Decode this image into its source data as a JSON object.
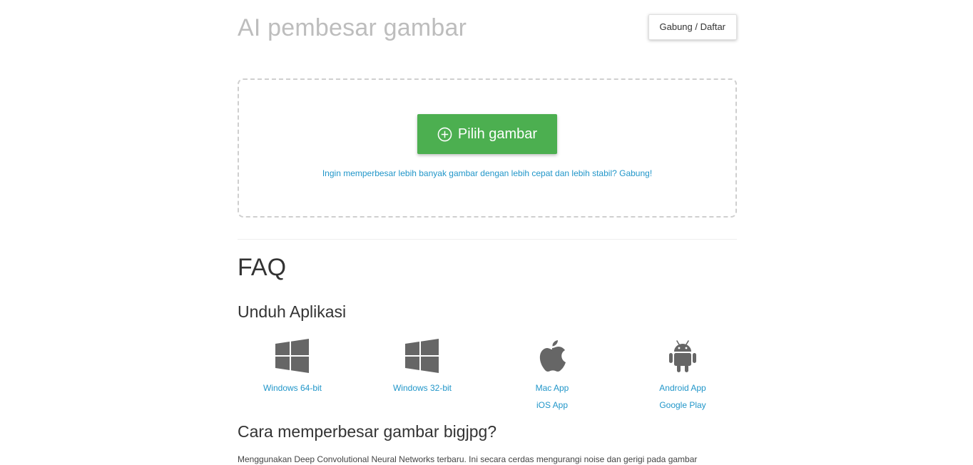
{
  "header": {
    "site_title": "AI pembesar gambar",
    "login_label": "Gabung / Daftar"
  },
  "upload": {
    "pick_label": "Pilih gambar",
    "upgrade_text": "Ingin memperbesar lebih banyak gambar dengan lebih cepat dan lebih stabil? Gabung!"
  },
  "faq": {
    "title": "FAQ",
    "apps_title": "Unduh Aplikasi",
    "apps": [
      {
        "icon": "windows-icon",
        "links": [
          "Windows 64-bit"
        ]
      },
      {
        "icon": "windows-icon",
        "links": [
          "Windows 32-bit"
        ]
      },
      {
        "icon": "apple-icon",
        "links": [
          "Mac App",
          "iOS App"
        ]
      },
      {
        "icon": "android-icon",
        "links": [
          "Android App",
          "Google Play"
        ]
      }
    ],
    "how_title": "Cara memperbesar gambar bigjpg?",
    "how_text": "Menggunakan Deep Convolutional Neural Networks terbaru. Ini secara cerdas mengurangi noise dan gerigi pada gambar"
  },
  "colors": {
    "accent_green": "#4caf50",
    "link_blue": "#2196c9",
    "icon_gray": "#666666"
  }
}
